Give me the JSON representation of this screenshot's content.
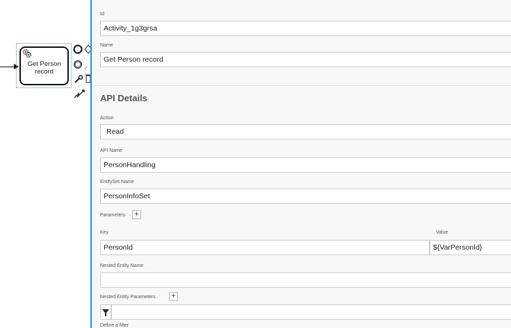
{
  "diagram": {
    "task": {
      "label": "Get Person record",
      "icon": "service-task-gear-icon"
    }
  },
  "panel": {
    "id": {
      "label": "Id",
      "value": "Activity_1g3grsa"
    },
    "name": {
      "label": "Name",
      "value": "Get Person record"
    },
    "api_details": {
      "title": "API Details",
      "action": {
        "label": "Action",
        "value": "Read"
      },
      "api_name": {
        "label": "API Name",
        "value": "PersonHandling"
      },
      "entityset": {
        "label": "EntitySet Name",
        "value": "PersonInfoSet"
      },
      "parameters": {
        "label": "Parameters",
        "add": "+",
        "columns": {
          "key": "Key",
          "value": "Value"
        },
        "rows": [
          {
            "key": "PersonId",
            "value": "${VarPersonId}"
          }
        ]
      },
      "nested_entity_name": {
        "label": "Nested Entity Name",
        "value": ""
      },
      "nested_entity_parameters": {
        "label": "Nested Entity Parameters",
        "add": "+"
      },
      "filter": {
        "label": "Define a filter",
        "icon": "filter-icon"
      }
    }
  },
  "colors": {
    "accent": "#1f8fe8",
    "selection": "#4a90e2",
    "panel_bg": "#f8f8f8"
  }
}
